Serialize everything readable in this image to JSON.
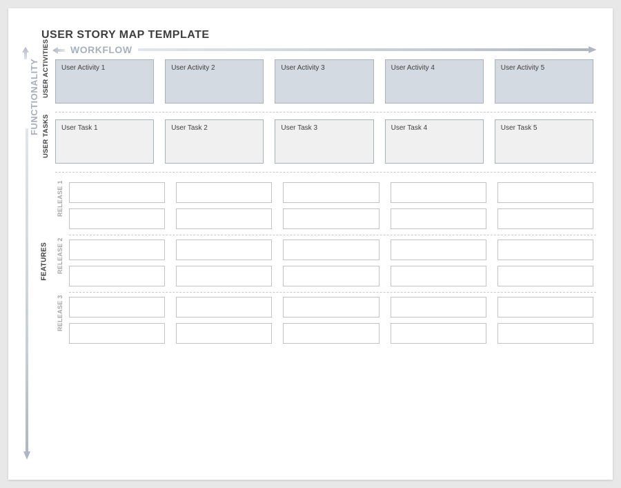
{
  "title": "USER STORY MAP TEMPLATE",
  "axes": {
    "workflow": "WORKFLOW",
    "functionality": "FUNCTIONALITY"
  },
  "sections": {
    "userActivities": {
      "label": "USER ACTIVITIES",
      "cards": [
        "User Activity 1",
        "User Activity 2",
        "User Activity 3",
        "User Activity 4",
        "User Activity 5"
      ]
    },
    "userTasks": {
      "label": "USER TASKS",
      "cards": [
        "User Task 1",
        "User Task 2",
        "User Task 3",
        "User Task 4",
        "User Task 5"
      ]
    },
    "features": {
      "label": "FEATURES",
      "releases": [
        {
          "label": "RELEASE 1"
        },
        {
          "label": "RELEASE 2"
        },
        {
          "label": "RELEASE 3"
        }
      ]
    }
  }
}
